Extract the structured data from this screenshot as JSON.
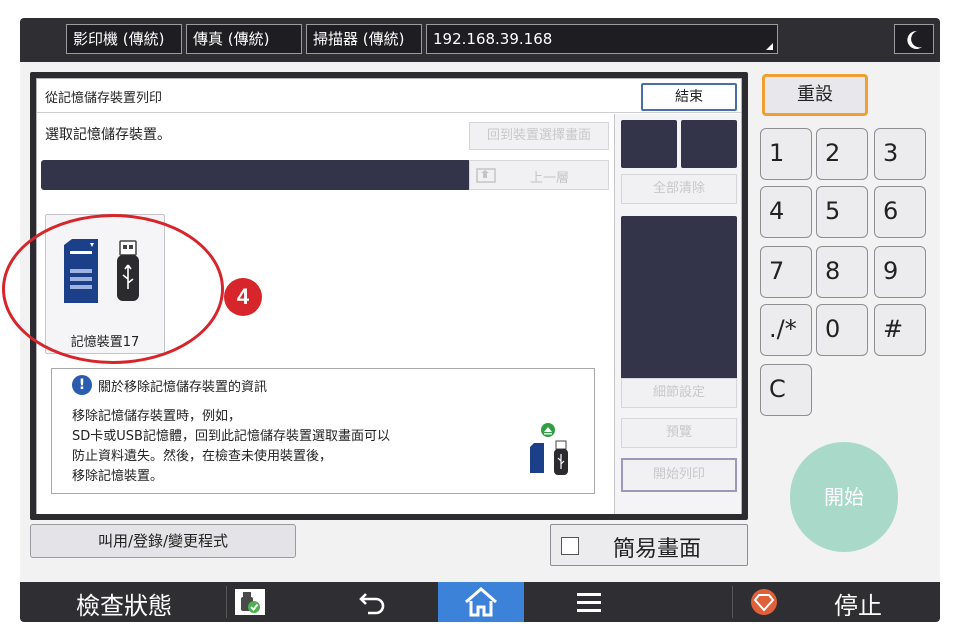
{
  "topbar": {
    "tabs": [
      "影印機 (傳統)",
      "傳真 (傳統)",
      "掃描器 (傳統)"
    ],
    "address": "192.168.39.168"
  },
  "dialog": {
    "title": "從記憶儲存裝置列印",
    "end_label": "結束",
    "prompt": "選取記憶儲存裝置。",
    "back_to_device_label": "回到裝置選擇畫面",
    "up_label": "上一層",
    "device_label": "記憶裝置17",
    "info_title": "關於移除記憶儲存裝置的資訊",
    "info_lines": [
      "移除記憶儲存裝置時，例如，",
      "SD卡或USB記憶體，回到此記憶儲存裝置選取畫面可以",
      "防止資料遺失。然後，在檢查未使用裝置後，",
      "移除記憶裝置。"
    ],
    "clear_all_label": "全部清除",
    "detail_settings_label": "細節設定",
    "preview_label": "預覽",
    "start_print_label": "開始列印"
  },
  "bottom": {
    "program_label": "叫用/登錄/變更程式",
    "simple_screen_label": "簡易畫面"
  },
  "keypad": {
    "reset_label": "重設",
    "keys": [
      "1",
      "2",
      "3",
      "4",
      "5",
      "6",
      "7",
      "8",
      "9",
      "./*",
      "0",
      "#",
      "C"
    ],
    "start_label": "開始"
  },
  "statusbar": {
    "check_status_label": "檢查狀態",
    "stop_label": "停止"
  },
  "annotation": {
    "step_number": "4"
  },
  "colors": {
    "accent_orange": "#f0a030",
    "home_blue": "#3c82d8",
    "start_green": "#a9d9c8",
    "annotation_red": "#d6262c",
    "dark_panel": "#33334a"
  }
}
